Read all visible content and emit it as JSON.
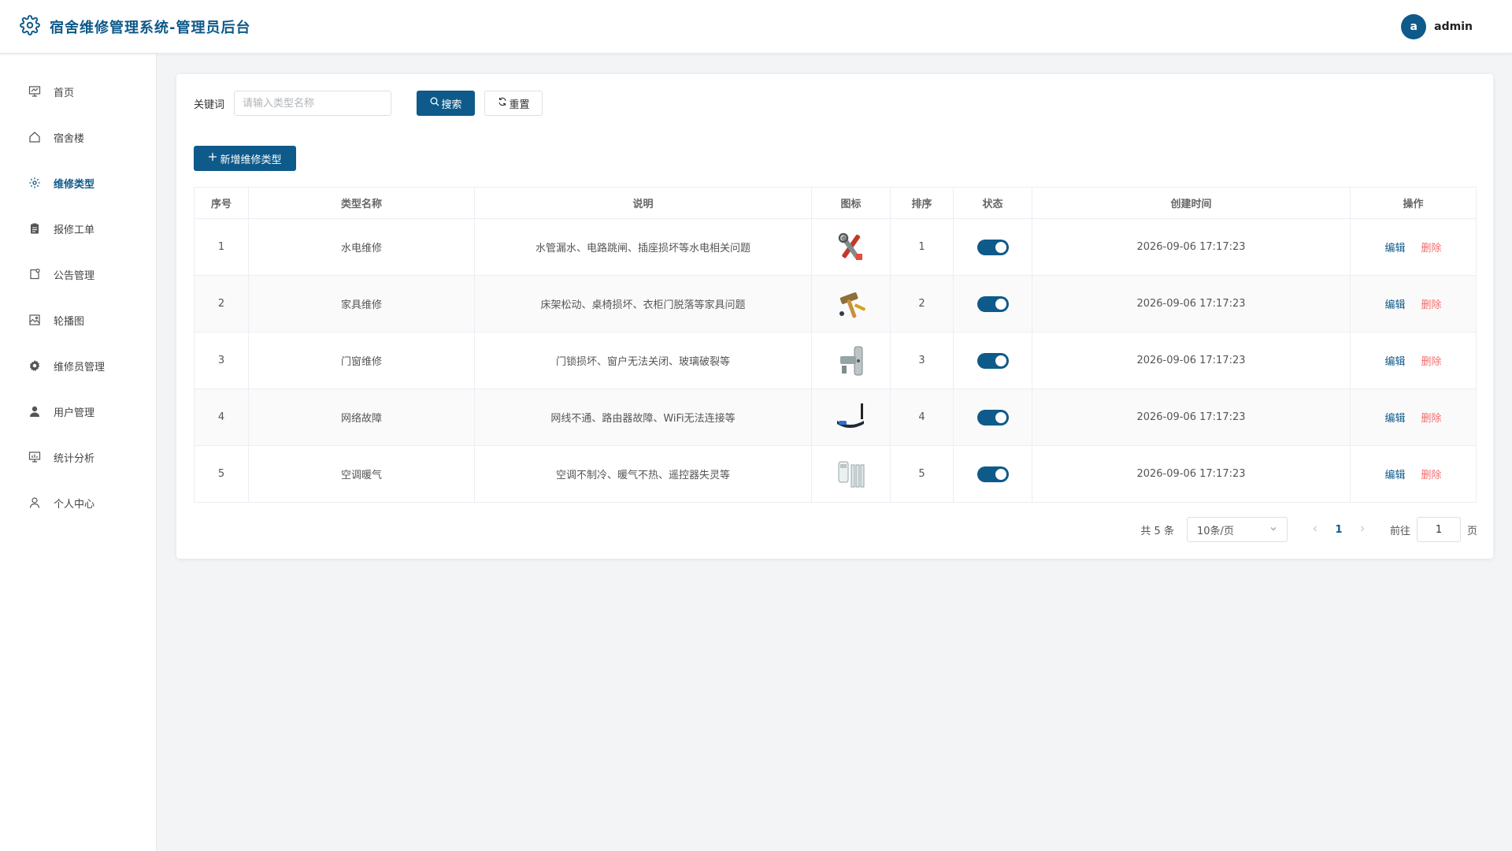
{
  "header": {
    "title": "宿舍维修管理系统-管理员后台",
    "avatar_letter": "a",
    "username": "admin"
  },
  "sidebar": {
    "items": [
      {
        "label": "首页",
        "icon": "presentation-icon"
      },
      {
        "label": "宿舍楼",
        "icon": "house-icon"
      },
      {
        "label": "维修类型",
        "icon": "gear-icon",
        "active": true
      },
      {
        "label": "报修工单",
        "icon": "clipboard-icon"
      },
      {
        "label": "公告管理",
        "icon": "notice-icon"
      },
      {
        "label": "轮播图",
        "icon": "picture-icon"
      },
      {
        "label": "维修员管理",
        "icon": "cog-filled-icon"
      },
      {
        "label": "用户管理",
        "icon": "user-filled-icon"
      },
      {
        "label": "统计分析",
        "icon": "chart-board-icon"
      },
      {
        "label": "个人中心",
        "icon": "user-outline-icon"
      }
    ]
  },
  "search": {
    "label": "关键词",
    "placeholder": "请输入类型名称",
    "value": "",
    "search_label": "搜索",
    "reset_label": "重置"
  },
  "add_button_label": "新增维修类型",
  "table": {
    "columns": [
      "序号",
      "类型名称",
      "说明",
      "图标",
      "排序",
      "状态",
      "创建时间",
      "操作"
    ],
    "rows": [
      {
        "index": "1",
        "name": "水电维修",
        "desc": "水管漏水、电路跳闸、插座损坏等水电相关问题",
        "icon": "wrench-tools-icon",
        "sort": "1",
        "status": true,
        "created": "2026-09-06 17:17:23"
      },
      {
        "index": "2",
        "name": "家具维修",
        "desc": "床架松动、桌椅损坏、衣柜门脱落等家具问题",
        "icon": "hammer-tools-icon",
        "sort": "2",
        "status": true,
        "created": "2026-09-06 17:17:23"
      },
      {
        "index": "3",
        "name": "门窗维修",
        "desc": "门锁损坏、窗户无法关闭、玻璃破裂等",
        "icon": "door-lock-icon",
        "sort": "3",
        "status": true,
        "created": "2026-09-06 17:17:23"
      },
      {
        "index": "4",
        "name": "网络故障",
        "desc": "网线不通、路由器故障、WiFi无法连接等",
        "icon": "router-icon",
        "sort": "4",
        "status": true,
        "created": "2026-09-06 17:17:23"
      },
      {
        "index": "5",
        "name": "空调暖气",
        "desc": "空调不制冷、暖气不热、遥控器失灵等",
        "icon": "remote-radiator-icon",
        "sort": "5",
        "status": true,
        "created": "2026-09-06 17:17:23"
      }
    ],
    "edit_label": "编辑",
    "delete_label": "删除"
  },
  "pagination": {
    "total_text": "共 5 条",
    "page_size": "10条/页",
    "current_page": "1",
    "goto_prefix": "前往",
    "goto_value": "1",
    "goto_suffix": "页"
  },
  "colors": {
    "primary": "#0e5a8a",
    "danger": "#f56c6c",
    "background": "#f3f4f6"
  }
}
